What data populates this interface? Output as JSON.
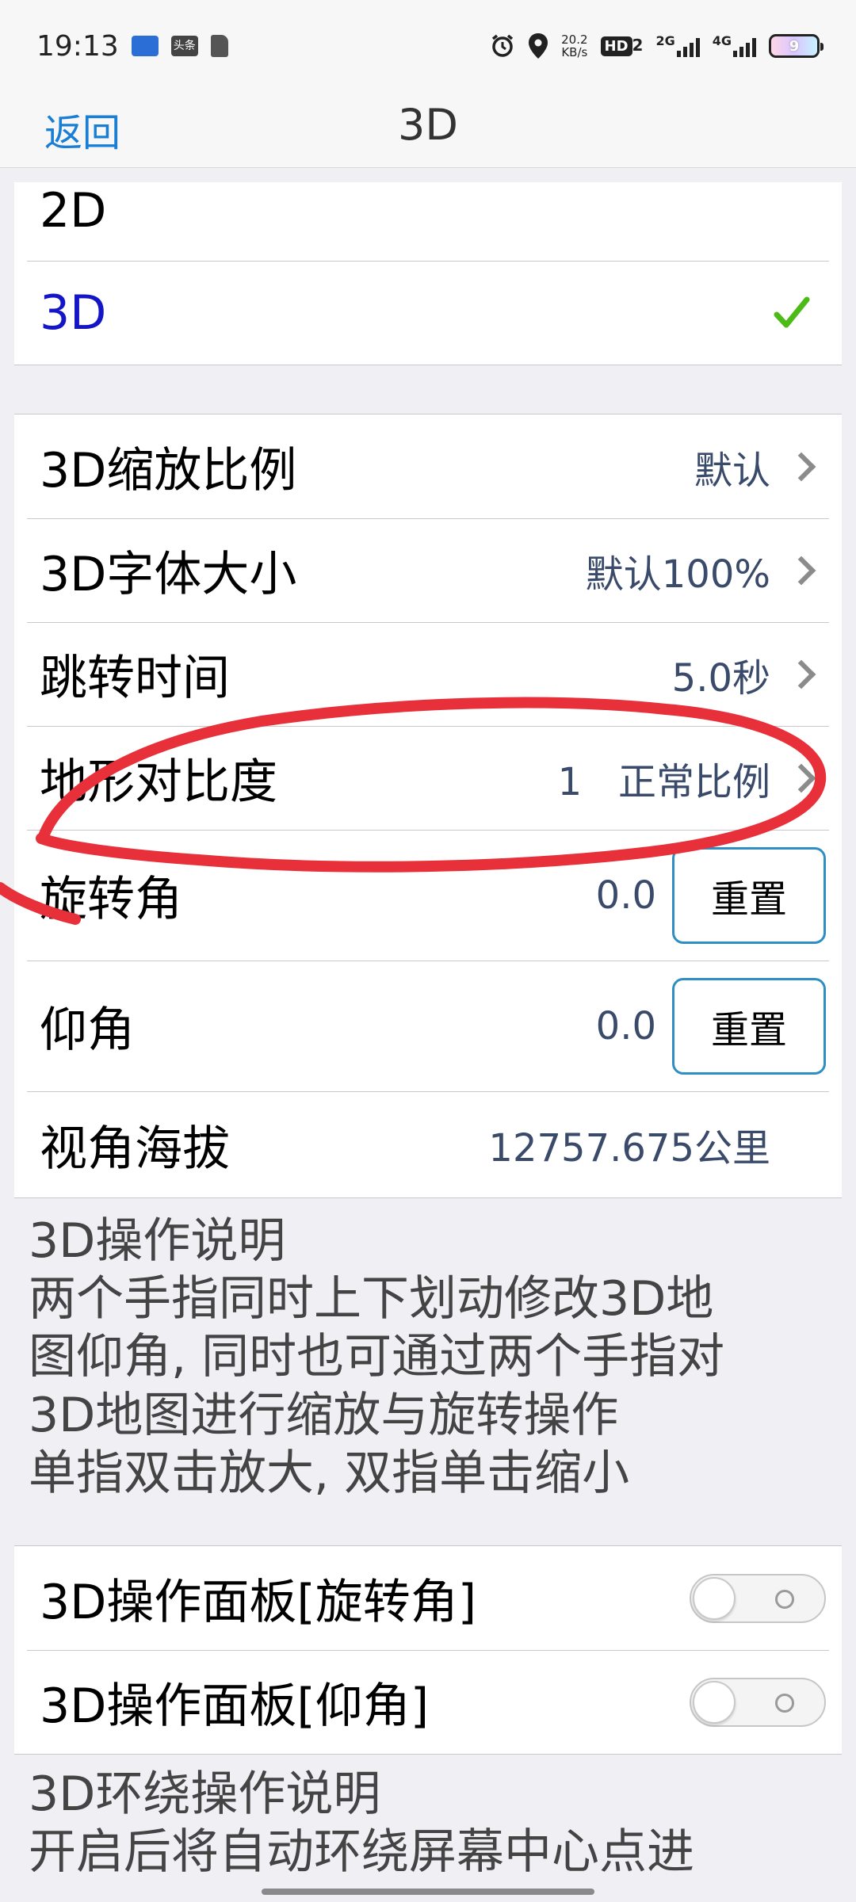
{
  "status_bar": {
    "time": "19:13",
    "app_icon_1": "头条",
    "speed_value": "20.2",
    "speed_unit": "KB/s",
    "hd_label": "HD",
    "hd_sub": "2",
    "net1": "2G",
    "net2": "4G",
    "battery": "9",
    "icons": [
      "alarm-icon",
      "location-icon",
      "signal-icon",
      "battery-icon"
    ]
  },
  "nav": {
    "back_label": "返回",
    "title": "3D"
  },
  "mode_group": {
    "items": [
      {
        "label": "2D",
        "selected": false
      },
      {
        "label": "3D",
        "selected": true
      }
    ],
    "check_color": "#4cbb17",
    "selected_color": "#1515c8"
  },
  "settings_group": {
    "scale": {
      "label": "3D缩放比例",
      "value": "默认"
    },
    "font_size": {
      "label": "3D字体大小",
      "value": "默认100%"
    },
    "jump_time": {
      "label": "跳转时间",
      "value": "5.0秒"
    },
    "terrain": {
      "label": "地形对比度",
      "value": "1   正常比例"
    },
    "rotation": {
      "label": "旋转角",
      "value": "0.0",
      "button": "重置"
    },
    "pitch": {
      "label": "仰角",
      "value": "0.0",
      "button": "重置"
    },
    "altitude": {
      "label": "视角海拔",
      "value": "12757.675公里"
    }
  },
  "op_desc": {
    "lines": [
      "3D操作说明",
      "两个手指同时上下划动修改3D地",
      "图仰角, 同时也可通过两个手指对",
      "3D地图进行缩放与旋转操作",
      "单指双击放大, 双指单击缩小"
    ]
  },
  "panel_group": {
    "rotation_panel": {
      "label": "3D操作面板[旋转角]",
      "on": false
    },
    "pitch_panel": {
      "label": "3D操作面板[仰角]",
      "on": false
    }
  },
  "orbit_desc": {
    "lines": [
      "3D环绕操作说明",
      "开启后将自动环绕屏幕中心点进"
    ]
  },
  "colors": {
    "accent": "#1a7fd4",
    "annotation": "#e8303a",
    "button_border": "#2f8ec2"
  }
}
